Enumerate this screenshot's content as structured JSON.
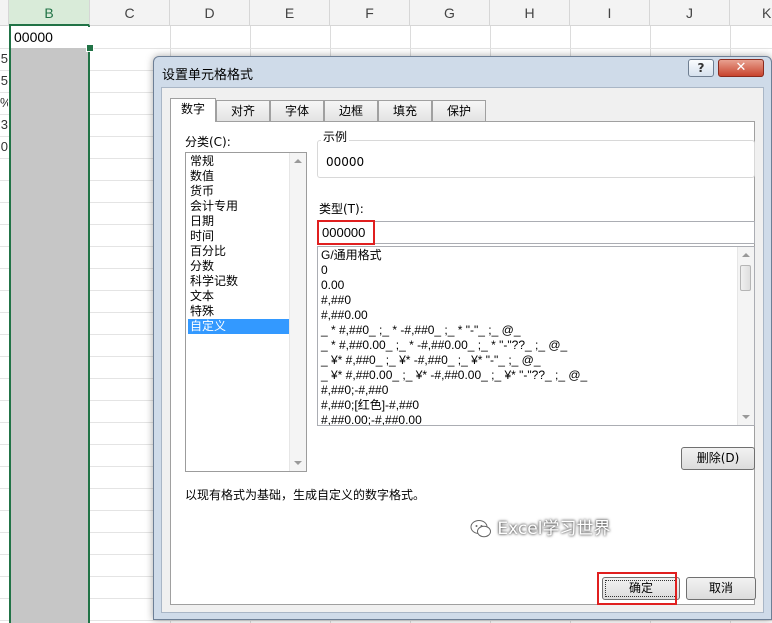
{
  "sheet": {
    "columns": [
      "B",
      "C",
      "D",
      "E",
      "F",
      "G",
      "H",
      "I",
      "J",
      "K"
    ],
    "selected_column": "B",
    "cell_b1": "00000",
    "left_fragments": [
      "5",
      "5",
      "%",
      "3",
      "0"
    ]
  },
  "dialog": {
    "title": "设置单元格格式",
    "help_label": "?",
    "close_label": "✕",
    "tabs": [
      "数字",
      "对齐",
      "字体",
      "边框",
      "填充",
      "保护"
    ],
    "active_tab": "数字",
    "category_label": "分类(C):",
    "categories": [
      "常规",
      "数值",
      "货币",
      "会计专用",
      "日期",
      "时间",
      "百分比",
      "分数",
      "科学记数",
      "文本",
      "特殊",
      "自定义"
    ],
    "selected_category": "自定义",
    "sample_label": "示例",
    "sample_value": "00000",
    "type_label": "类型(T):",
    "type_value": "000000",
    "formats": [
      "G/通用格式",
      "0",
      "0.00",
      "#,##0",
      "#,##0.00",
      "_ * #,##0_ ;_ * -#,##0_ ;_ * \"-\"_ ;_ @_",
      "_ * #,##0.00_ ;_ * -#,##0.00_ ;_ * \"-\"??_ ;_ @_",
      "_ ¥* #,##0_ ;_ ¥* -#,##0_ ;_ ¥* \"-\"_ ;_ @_",
      "_ ¥* #,##0.00_ ;_ ¥* -#,##0.00_ ;_ ¥* \"-\"??_ ;_ @_",
      "#,##0;-#,##0",
      "#,##0;[红色]-#,##0",
      "#,##0.00;-#,##0.00"
    ],
    "delete_label": "删除(D)",
    "description": "以现有格式为基础，生成自定义的数字格式。",
    "ok_label": "确定",
    "cancel_label": "取消"
  },
  "watermark": "Excel学习世界",
  "colors": {
    "highlight_red": "#e01f1f",
    "selection_blue": "#3399ff",
    "excel_green": "#217346"
  }
}
